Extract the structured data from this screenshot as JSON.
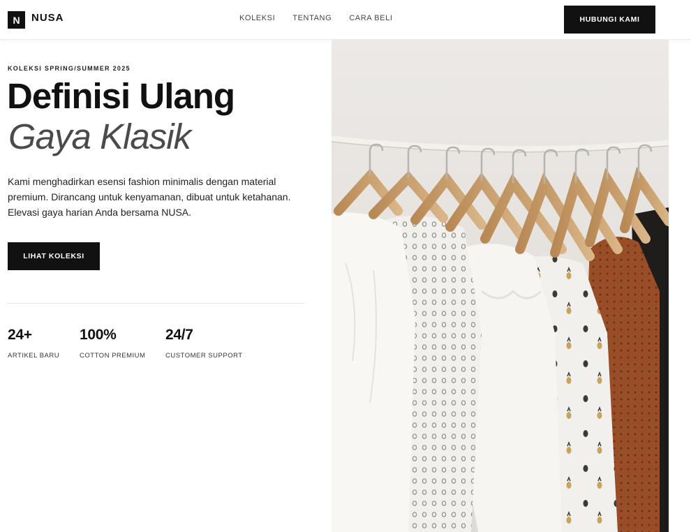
{
  "brand": {
    "logo_letter": "N",
    "name": "NUSA"
  },
  "nav": {
    "items": [
      {
        "label": "KOLEKSI"
      },
      {
        "label": "TENTANG"
      },
      {
        "label": "CARA BELI"
      }
    ],
    "cta_label": "HUBUNGI KAMI"
  },
  "hero": {
    "eyebrow": "KOLEKSI SPRING/SUMMER 2025",
    "headline_line1": "Definisi Ulang",
    "headline_line2": "Gaya Klasik",
    "description": "Kami menghadirkan esensi fashion minimalis dengan material premium. Dirancang untuk kenyamanan, dibuat untuk ketahanan. Elevasi gaya harian Anda bersama NUSA.",
    "button_label": "LIHAT KOLEKSI",
    "stats": [
      {
        "value": "24+",
        "label": "ARTIKEL BARU"
      },
      {
        "value": "100%",
        "label": "COTTON PREMIUM"
      },
      {
        "value": "24/7",
        "label": "CUSTOMER SUPPORT"
      }
    ]
  },
  "image": {
    "subject": "clothing-rack-with-shirts-on-wooden-hangers"
  },
  "colors": {
    "primary": "#111111",
    "background": "#ffffff",
    "headline_italic": "#4a4a4a",
    "wall": "#e9e7e4",
    "rail": "#f1efea",
    "hanger": "#c99c6b",
    "rust_shirt": "#9a4e27"
  }
}
